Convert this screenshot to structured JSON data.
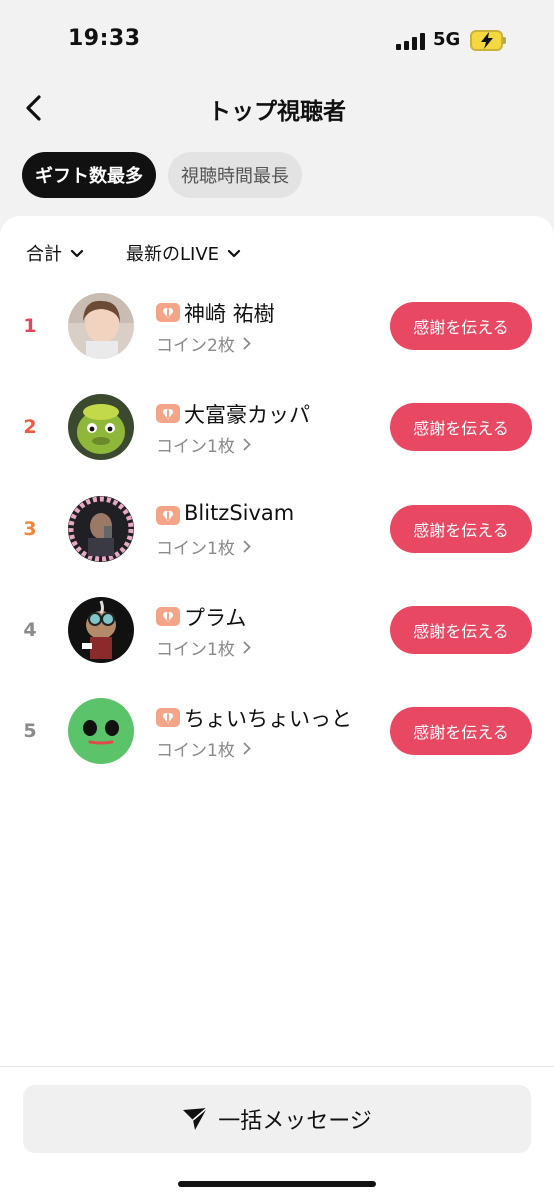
{
  "status_bar": {
    "time": "19:33",
    "network": "5G"
  },
  "header": {
    "title": "トップ視聴者"
  },
  "tabs": [
    {
      "label": "ギフト数最多",
      "active": true
    },
    {
      "label": "視聴時間最長",
      "active": false
    }
  ],
  "filters": {
    "period": "合計",
    "scope": "最新のLIVE"
  },
  "viewers": [
    {
      "rank": "1",
      "name": "神崎 祐樹",
      "coins": "コイン2枚",
      "button": "感謝を伝える",
      "rank_color": "#e8435e"
    },
    {
      "rank": "2",
      "name": "大富豪カッパ",
      "coins": "コイン1枚",
      "button": "感謝を伝える",
      "rank_color": "#ef5a45"
    },
    {
      "rank": "3",
      "name": "BlitzSivam",
      "coins": "コイン1枚",
      "button": "感謝を伝える",
      "rank_color": "#f0853a"
    },
    {
      "rank": "4",
      "name": "プラム",
      "coins": "コイン1枚",
      "button": "感謝を伝える",
      "rank_color": "#8a8a8a"
    },
    {
      "rank": "5",
      "name": "ちょいちょいっと",
      "coins": "コイン1枚",
      "button": "感謝を伝える",
      "rank_color": "#8a8a8a"
    }
  ],
  "bottom": {
    "bulk_message": "一括メッセージ"
  },
  "colors": {
    "accent": "#e94862",
    "active_tab": "#111111",
    "badge": "#f4a487"
  }
}
